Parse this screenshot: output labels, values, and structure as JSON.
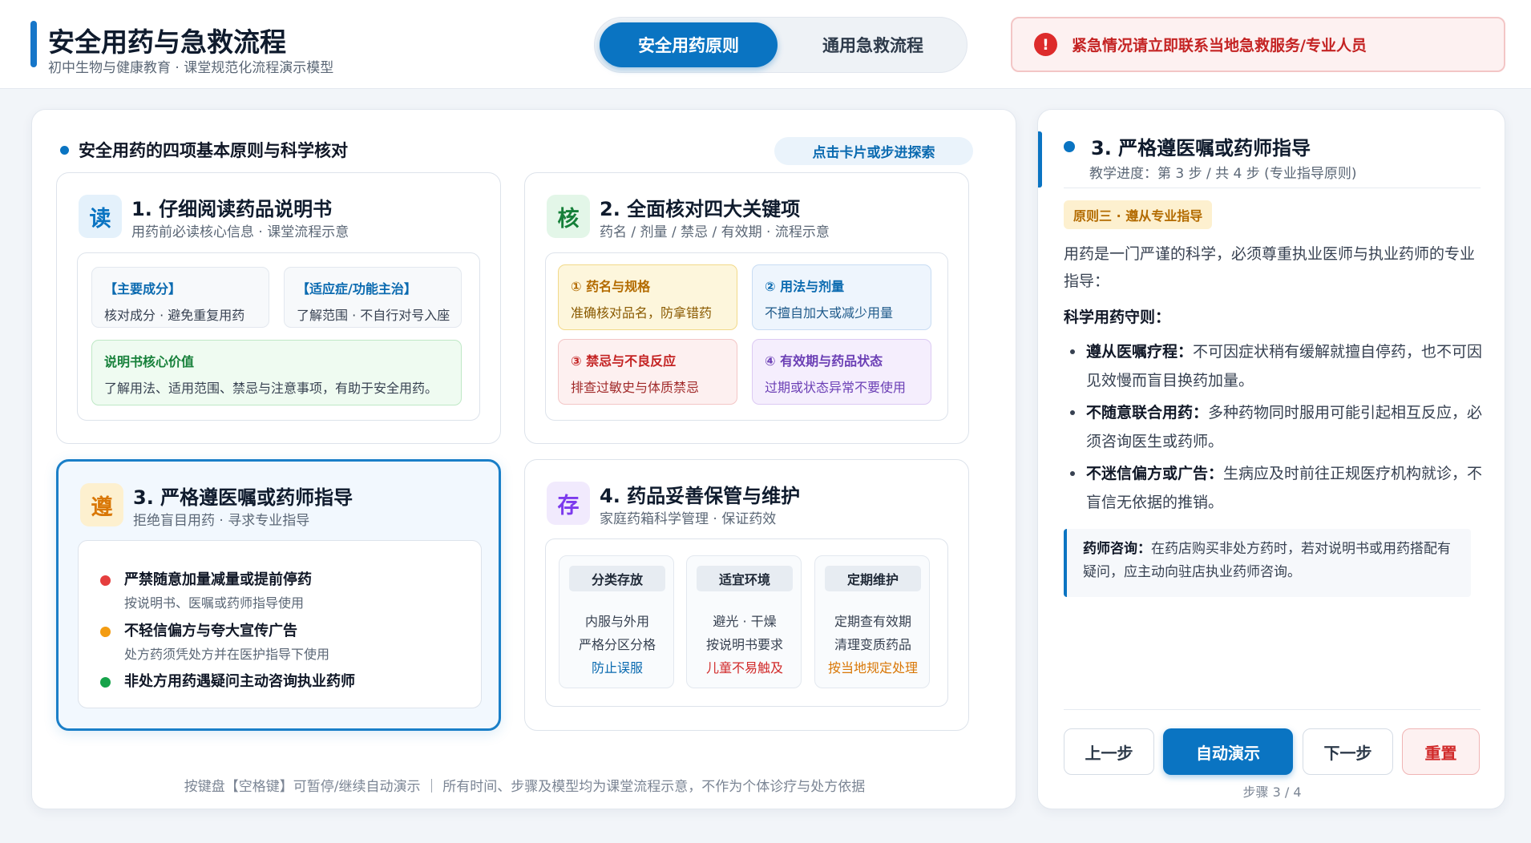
{
  "header": {
    "title": "安全用药与急救流程",
    "subtitle": "初中生物与健康教育 · 课堂规范化流程演示模型",
    "tabs": [
      {
        "label": "安全用药原则",
        "active": true
      },
      {
        "label": "通用急救流程",
        "active": false
      }
    ],
    "alert": {
      "icon": "exclamation-icon",
      "glyph": "!",
      "text": "紧急情况请立即联系当地急救服务/专业人员"
    }
  },
  "main": {
    "section_title": "安全用药的四项基本原则与科学核对",
    "hint": "点击卡片或步进探索",
    "cards": [
      {
        "badge": "读",
        "title": "1. 仔细阅读药品说明书",
        "subtitle": "用药前必读核心信息 · 课堂流程示意",
        "boxes": [
          {
            "heading": "【主要成分】",
            "text": "核对成分 · 避免重复用药"
          },
          {
            "heading": "【适应症/功能主治】",
            "text": "了解范围 · 不自行对号入座"
          },
          {
            "heading": "说明书核心价值",
            "text": "了解用法、适用范围、禁忌与注意事项，有助于安全用药。"
          }
        ]
      },
      {
        "badge": "核",
        "title": "2. 全面核对四大关键项",
        "subtitle": "药名 / 剂量 / 禁忌 / 有效期 · 流程示意",
        "boxes": [
          {
            "heading": "① 药名与规格",
            "text": "准确核对品名，防拿错药"
          },
          {
            "heading": "② 用法与剂量",
            "text": "不擅自加大或减少用量"
          },
          {
            "heading": "③ 禁忌与不良反应",
            "text": "排查过敏史与体质禁忌"
          },
          {
            "heading": "④ 有效期与药品状态",
            "text": "过期或状态异常不要使用"
          }
        ]
      },
      {
        "badge": "遵",
        "title": "3. 严格遵医嘱或药师指导",
        "subtitle": "拒绝盲目用药 · 寻求专业指导",
        "active": true,
        "bullets": [
          {
            "heading": "严禁随意加量减量或提前停药",
            "text": "按说明书、医嘱或药师指导使用",
            "color": "#e53e3e"
          },
          {
            "heading": "不轻信偏方与夸大宣传广告",
            "text": "处方药须凭处方并在医护指导下使用",
            "color": "#f39c12"
          },
          {
            "heading": "非处方用药遇疑问主动咨询执业药师",
            "text": "",
            "color": "#16a34a"
          }
        ]
      },
      {
        "badge": "存",
        "title": "4. 药品妥善保管与维护",
        "subtitle": "家庭药箱科学管理 · 保证药效",
        "columns": [
          {
            "heading": "分类存放",
            "lines": [
              "内服与外用",
              "严格分区分格",
              "防止误服"
            ],
            "accent": "#0a6ab0"
          },
          {
            "heading": "适宜环境",
            "lines": [
              "避光 · 干燥",
              "按说明书要求",
              "儿童不易触及"
            ],
            "accent": "#d12a2a"
          },
          {
            "heading": "定期维护",
            "lines": [
              "定期查有效期",
              "清理变质药品",
              "按当地规定处理"
            ],
            "accent": "#d97706"
          }
        ]
      }
    ],
    "footnote": "按键盘【空格键】可暂停/继续自动演示 ｜ 所有时间、步骤及模型均为课堂流程示意，不作为个体诊疗与处方依据"
  },
  "side": {
    "title": "3. 严格遵医嘱或药师指导",
    "progress": "教学进度：第 3 步 / 共 4 步 (专业指导原则)",
    "principle_tag": "原则三 · 遵从专业指导",
    "intro": "用药是一门严谨的科学，必须尊重执业医师与执业药师的专业指导：",
    "rules_heading": "科学用药守则：",
    "rules": [
      {
        "bold": "遵从医嘱疗程：",
        "text": "不可因症状稍有缓解就擅自停药，也不可因见效慢而盲目换药加量。"
      },
      {
        "bold": "不随意联合用药：",
        "text": "多种药物同时服用可能引起相互反应，必须咨询医生或药师。"
      },
      {
        "bold": "不迷信偏方或广告：",
        "text": "生病应及时前往正规医疗机构就诊，不盲信无依据的推销。"
      }
    ],
    "consult": {
      "bold": "药师咨询：",
      "text": "在药店购买非处方药时，若对说明书或用药搭配有疑问，应主动向驻店执业药师咨询。"
    },
    "buttons": {
      "prev": "上一步",
      "auto": "自动演示",
      "next": "下一步",
      "reset": "重置"
    },
    "step_indicator": "步骤 3 / 4"
  },
  "colors": {
    "accent": "#0a74c2",
    "alert": "#c42323",
    "active_border": "#1a7fc8"
  }
}
